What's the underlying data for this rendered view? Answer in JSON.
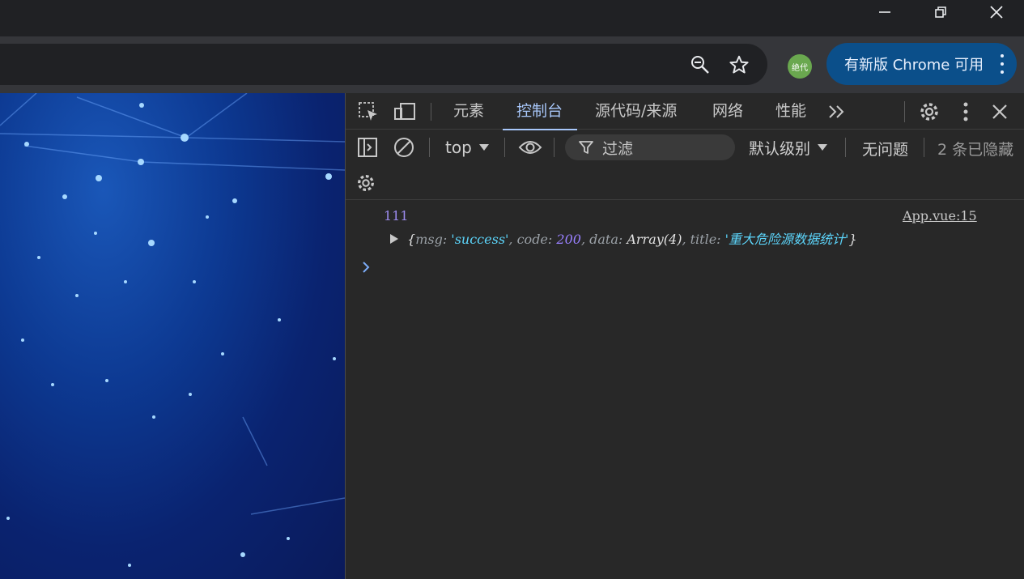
{
  "browser": {
    "update_banner": "有新版 Chrome 可用",
    "extension_badge": "绝代"
  },
  "devtools": {
    "tabs": [
      "元素",
      "控制台",
      "源代码/来源",
      "网络",
      "性能"
    ],
    "active_tab": "控制台",
    "context": "top",
    "filter_placeholder": "过滤",
    "level": "默认级别",
    "issues": "无问题",
    "hidden": "2 条已隐藏",
    "accent_color": "#a8c7fa"
  },
  "console": {
    "log_text": "111",
    "source": "App.vue:15",
    "object": {
      "open": "{",
      "msg_key": "msg",
      "msg_value": "'success'",
      "code_key": "code",
      "code_value": "200",
      "data_key": "data",
      "data_value": "Array(4)",
      "title_key": "title",
      "title_value": "'重大危险源数据统计'",
      "close": "}"
    }
  }
}
